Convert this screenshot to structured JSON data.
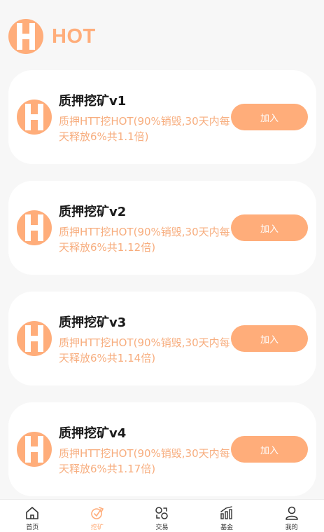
{
  "header": {
    "brand": "HOT",
    "logo_icon": "hot-h-logo-icon"
  },
  "colors": {
    "accent": "#ffad7a",
    "desc_text": "#f7ad7e",
    "title_text": "#1a1a1a",
    "background": "#f7f7f7"
  },
  "cards": [
    {
      "title": "质押挖矿v1",
      "desc": "质押HTT挖HOT(90%销毁,30天内每天释放6%共1.1倍)",
      "button": "加入"
    },
    {
      "title": "质押挖矿v2",
      "desc": "质押HTT挖HOT(90%销毁,30天内每天释放6%共1.12倍)",
      "button": "加入"
    },
    {
      "title": "质押挖矿v3",
      "desc": "质押HTT挖HOT(90%销毁,30天内每天释放6%共1.14倍)",
      "button": "加入"
    },
    {
      "title": "质押挖矿v4",
      "desc": "质押HTT挖HOT(90%销毁,30天内每天释放6%共1.17倍)",
      "button": "加入"
    }
  ],
  "tabbar": [
    {
      "label": "首页",
      "icon": "home-icon",
      "active": false
    },
    {
      "label": "挖矿",
      "icon": "mining-icon",
      "active": true
    },
    {
      "label": "交易",
      "icon": "exchange-icon",
      "active": false
    },
    {
      "label": "基金",
      "icon": "fund-chart-icon",
      "active": false
    },
    {
      "label": "我的",
      "icon": "user-icon",
      "active": false
    }
  ]
}
